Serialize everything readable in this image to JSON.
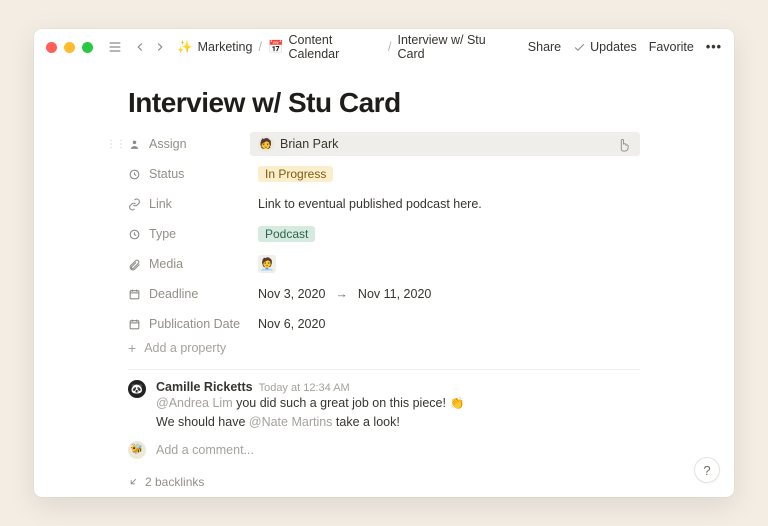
{
  "breadcrumbs": [
    {
      "icon": "✨",
      "label": "Marketing"
    },
    {
      "icon": "📅",
      "label": "Content Calendar"
    },
    {
      "icon": "",
      "label": "Interview w/ Stu Card"
    }
  ],
  "top_actions": {
    "share": "Share",
    "updates": "Updates",
    "favorite": "Favorite"
  },
  "page_title": "Interview w/ Stu Card",
  "properties": {
    "assign": {
      "label": "Assign",
      "value": "Brian Park"
    },
    "status": {
      "label": "Status",
      "value": "In Progress"
    },
    "link": {
      "label": "Link",
      "value": "Link to eventual published podcast here."
    },
    "type": {
      "label": "Type",
      "value": "Podcast"
    },
    "media": {
      "label": "Media"
    },
    "deadline": {
      "label": "Deadline",
      "from": "Nov 3, 2020",
      "to": "Nov 11, 2020"
    },
    "pubdate": {
      "label": "Publication Date",
      "value": "Nov 6, 2020"
    }
  },
  "add_property_label": "Add a property",
  "comment": {
    "author": "Camille Ricketts",
    "time": "Today at 12:34 AM",
    "mention1": "@Andrea Lim",
    "text1": " you did such a great job on this piece! ",
    "emoji": "👏",
    "text2_prefix": "We should have ",
    "mention2": "@Nate Martins",
    "text2_suffix": " take a look!"
  },
  "add_comment_placeholder": "Add a comment...",
  "backlinks_label": "2 backlinks",
  "help_label": "?"
}
